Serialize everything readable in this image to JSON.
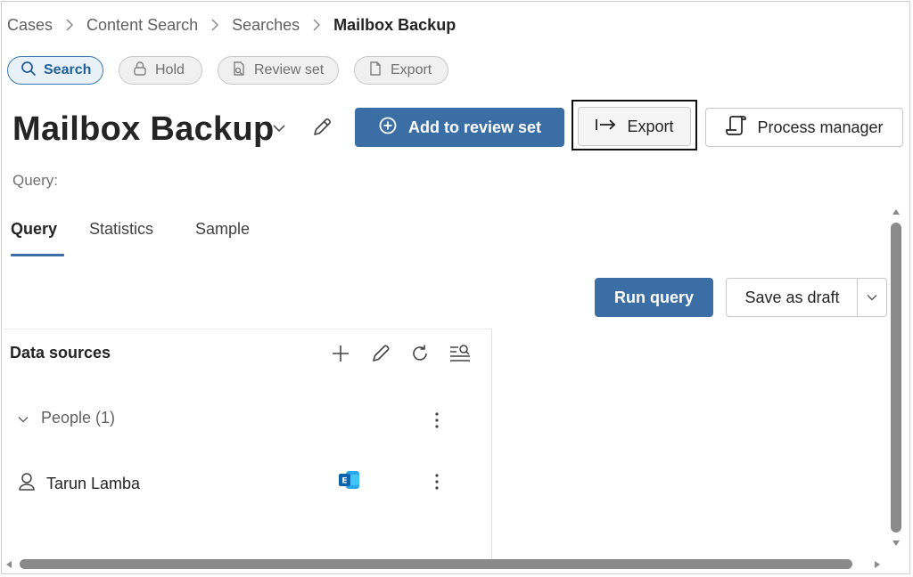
{
  "breadcrumb": {
    "items": [
      "Cases",
      "Content Search",
      "Searches"
    ],
    "current": "Mailbox Backup"
  },
  "pills": [
    {
      "label": "Search",
      "icon": "search-icon",
      "active": true
    },
    {
      "label": "Hold",
      "icon": "lock-icon",
      "active": false
    },
    {
      "label": "Review set",
      "icon": "review-set-icon",
      "active": false
    },
    {
      "label": "Export",
      "icon": "export-doc-icon",
      "active": false
    }
  ],
  "header": {
    "title": "Mailbox Backup",
    "add_to_review_label": "Add to review set",
    "export_label": "Export",
    "process_manager_label": "Process manager"
  },
  "query_label": "Query:",
  "tabs": [
    {
      "label": "Query",
      "active": true
    },
    {
      "label": "Statistics",
      "active": false
    },
    {
      "label": "Sample",
      "active": false
    }
  ],
  "actions": {
    "run_query_label": "Run query",
    "save_draft_label": "Save as draft"
  },
  "data_sources": {
    "title": "Data sources",
    "toolbar_icons": [
      "add-icon",
      "edit-icon",
      "refresh-icon",
      "filter-search-icon"
    ],
    "group_label": "People (1)",
    "person_name": "Tarun Lamba",
    "person_source_icon": "exchange-icon"
  },
  "colors": {
    "primary": "#3a6ea5",
    "active_pill_border": "#3a78b5",
    "active_pill_bg": "#e8f1f8",
    "exchange_blue": "#1a7bd0"
  }
}
